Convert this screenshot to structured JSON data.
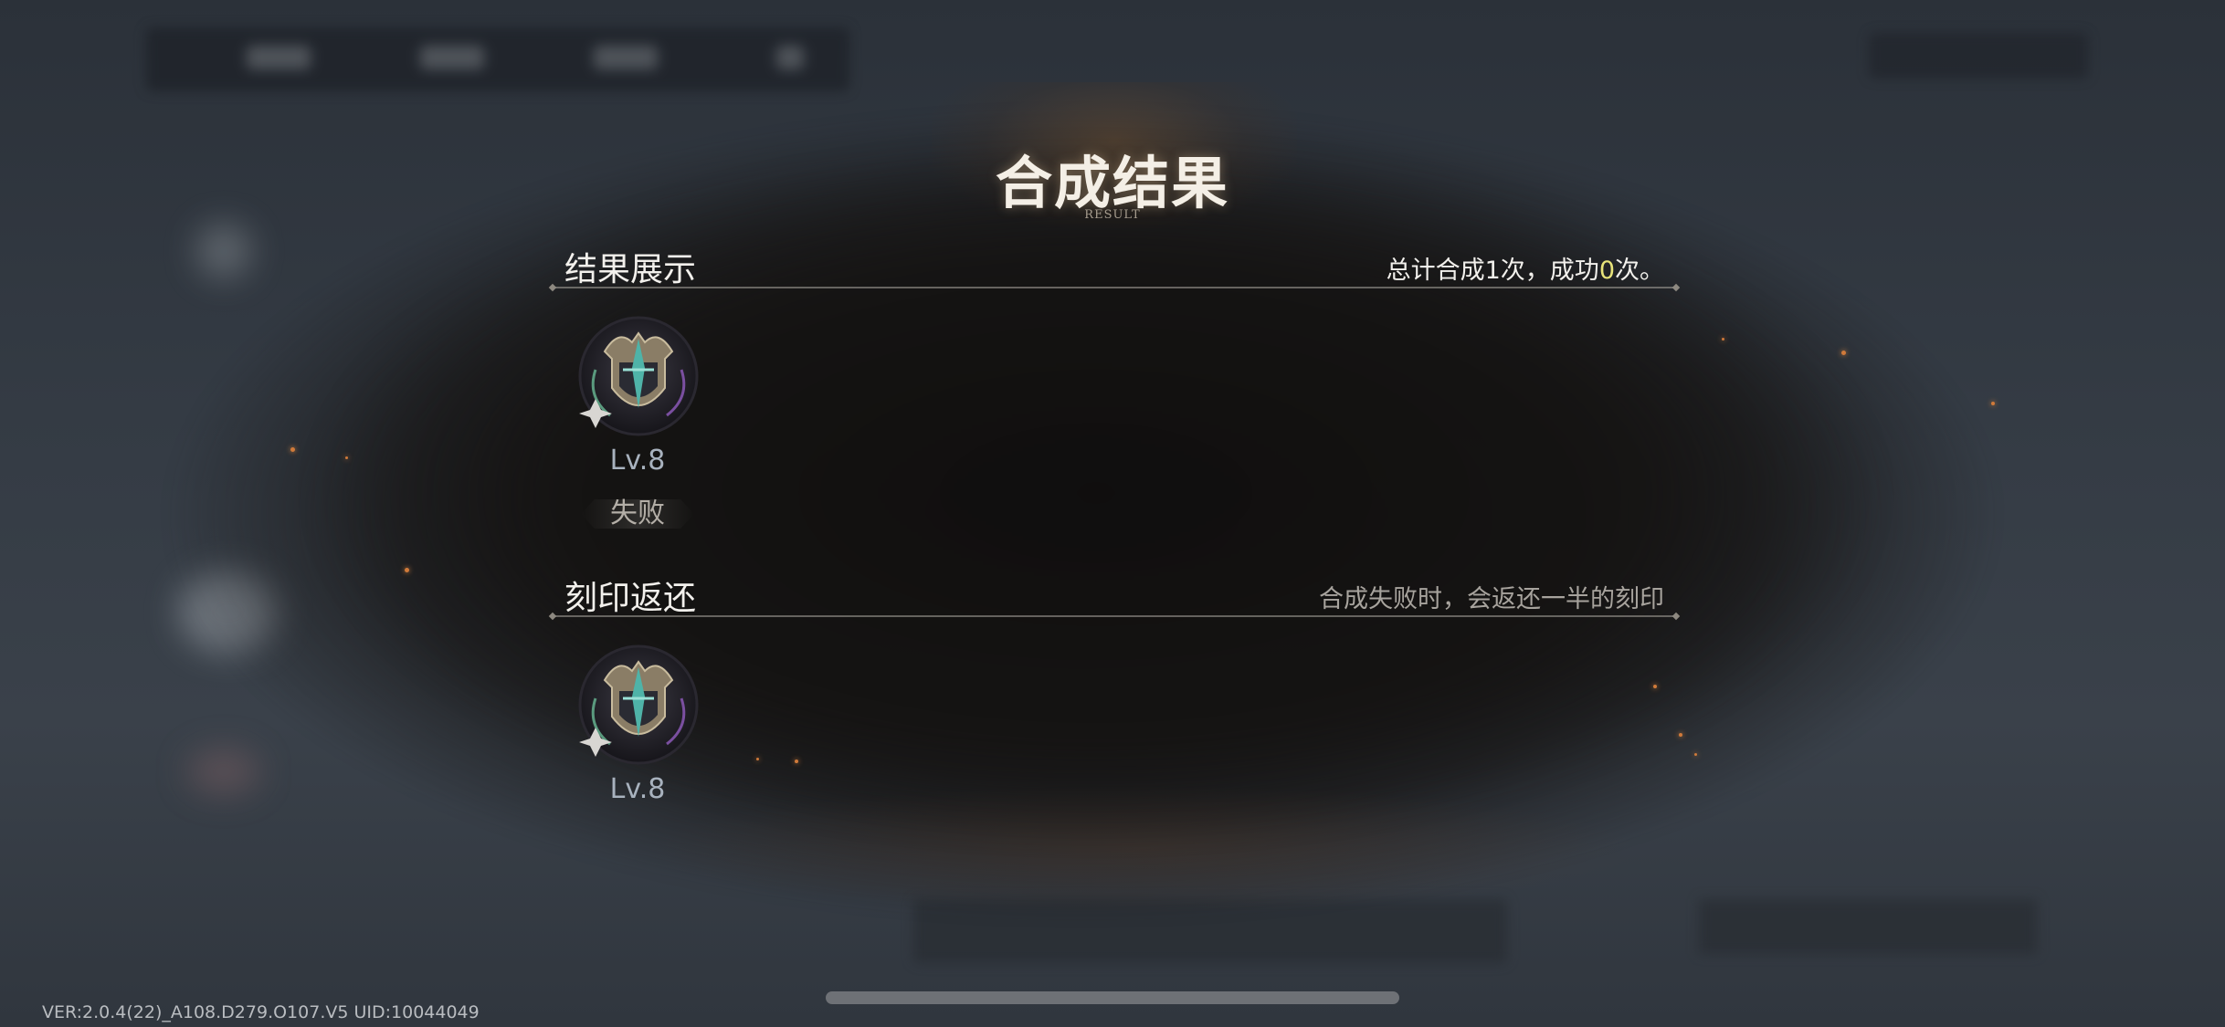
{
  "title": "合成结果",
  "subtitle": "RESULT",
  "result_section": {
    "title": "结果展示",
    "summary_prefix": "总计合成1次，成功",
    "summary_success": "0",
    "summary_suffix": "次。",
    "items": [
      {
        "level": "Lv.8",
        "status": "失败",
        "icon": "emblem-shield-icon"
      }
    ]
  },
  "return_section": {
    "title": "刻印返还",
    "note": "合成失败时，会返还一半的刻印",
    "items": [
      {
        "level": "Lv.8",
        "icon": "emblem-shield-icon"
      }
    ]
  },
  "footer": {
    "version": "VER:2.0.4(22)_A108.D279.O107.V5    UID:10044049"
  },
  "colors": {
    "highlight": "#e8e47a",
    "text": "#f2f0ec",
    "dim_text": "#a7a39d"
  }
}
